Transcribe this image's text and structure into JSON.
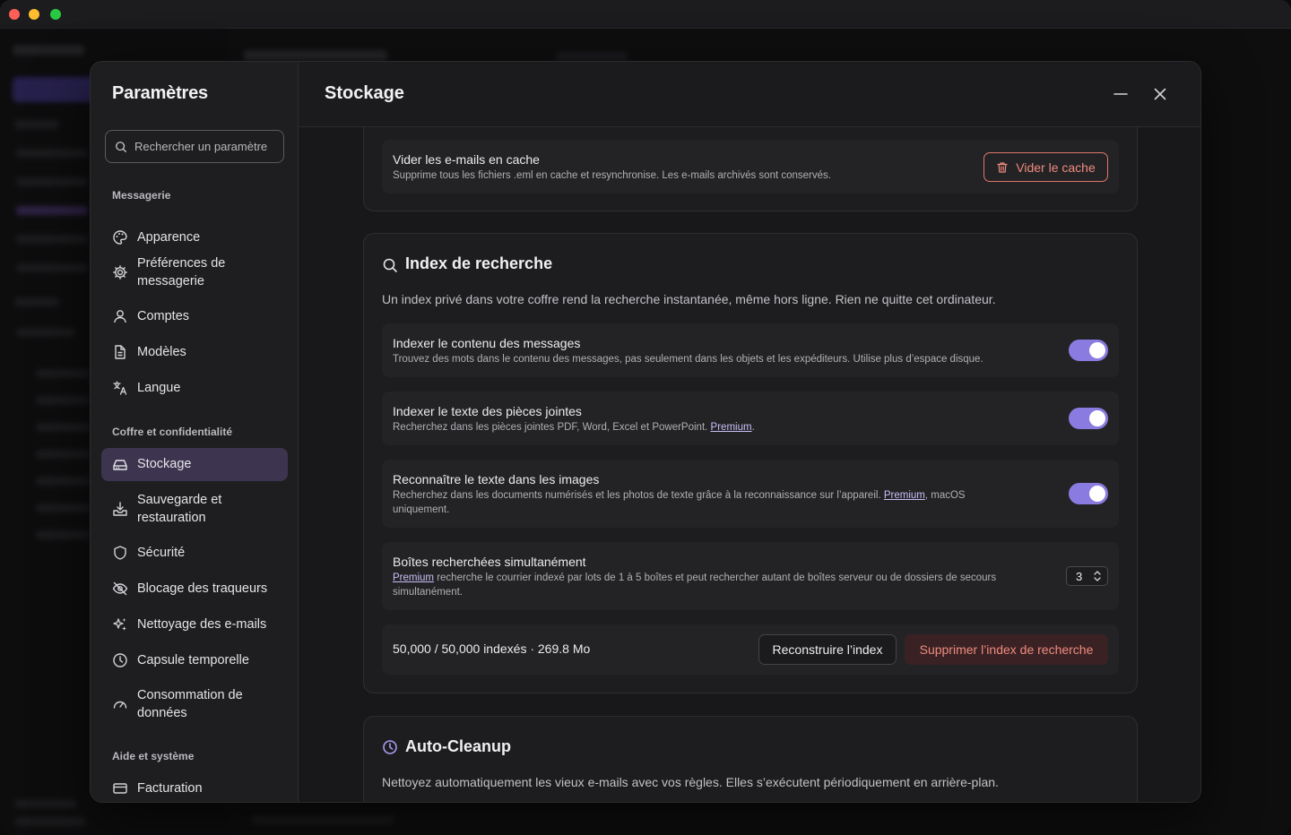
{
  "modal": {
    "title": "Paramètres",
    "search_placeholder": "Rechercher un paramètre",
    "groups": {
      "messagerie": "Messagerie",
      "coffre": "Coffre et confidentialité",
      "aide": "Aide et système"
    },
    "nav": {
      "apparence": "Apparence",
      "preferences": "Préférences de messagerie",
      "comptes": "Comptes",
      "modeles": "Modèles",
      "langue": "Langue",
      "stockage": "Stockage",
      "sauvegarde": "Sauvegarde et restauration",
      "securite": "Sécurité",
      "blocage": "Blocage des traqueurs",
      "nettoyage": "Nettoyage des e-mails",
      "capsule": "Capsule temporelle",
      "consommation": "Consommation de données",
      "facturation": "Facturation"
    },
    "active_item": "Stockage"
  },
  "page": {
    "title": "Stockage",
    "cache": {
      "title": "Vider les e-mails en cache",
      "desc": "Supprime tous les fichiers .eml en cache et resynchronise. Les e-mails archivés sont conservés.",
      "button": "Vider le cache"
    },
    "index": {
      "title": "Index de recherche",
      "desc": "Un index privé dans votre coffre rend la recherche instantanée, même hors ligne. Rien ne quitte cet ordinateur.",
      "content": {
        "title": "Indexer le contenu des messages",
        "desc": "Trouvez des mots dans le contenu des messages, pas seulement dans les objets et les expéditeurs. Utilise plus d’espace disque.",
        "enabled": true
      },
      "attachments": {
        "title": "Indexer le texte des pièces jointes",
        "desc": "Recherchez dans les pièces jointes PDF, Word, Excel et PowerPoint.",
        "link": "Premium",
        "enabled": true
      },
      "images": {
        "title": "Reconnaître le texte dans les images",
        "desc": "Recherchez dans les documents numérisés et les photos de texte grâce à la reconnaissance sur l’appareil.",
        "link": "Premium",
        "desc_suffix": ", macOS uniquement.",
        "enabled": true
      },
      "mailboxes": {
        "title": "Boîtes recherchées simultanément",
        "link": "Premium",
        "desc": " recherche le courrier indexé par lots de 1 à 5 boîtes et peut rechercher autant de boîtes serveur ou de dossiers de secours simultanément.",
        "value": "3"
      },
      "status": "50,000 / 50,000 indexés · 269.8 Mo",
      "rebuild": "Reconstruire l’index",
      "delete": "Supprimer l’index de recherche"
    },
    "cleanup": {
      "title": "Auto-Cleanup",
      "desc": "Nettoyez automatiquement les vieux e-mails avec vos règles. Elles s’exécutent périodiquement en arrière-plan."
    }
  },
  "colors": {
    "accent": "#8a7be0",
    "active_nav": "#3d3550",
    "danger": "#f08a7e"
  }
}
